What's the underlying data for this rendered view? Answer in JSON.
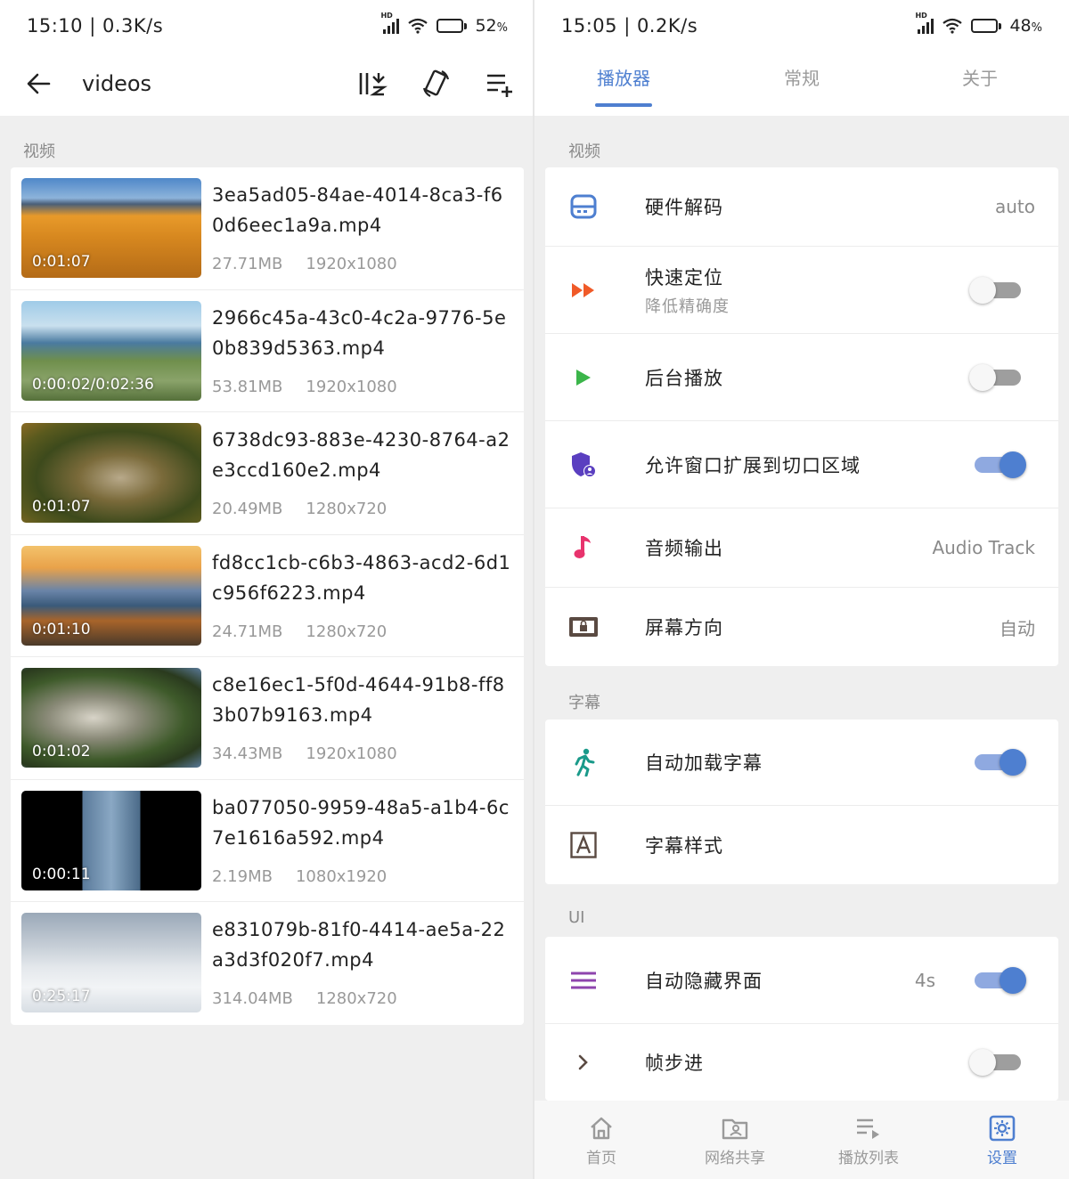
{
  "left": {
    "status": {
      "time": "15:10 | 0.3K/s",
      "battery": "52",
      "battery_unit": "%"
    },
    "appbar": {
      "title": "videos"
    },
    "section_label": "视频",
    "videos": [
      {
        "name": "3ea5ad05-84ae-4014-8ca3-f60d6eec1a9a.mp4",
        "duration": "0:01:07",
        "size": "27.71MB",
        "resolution": "1920x1080"
      },
      {
        "name": "2966c45a-43c0-4c2a-9776-5e0b839d5363.mp4",
        "duration": "0:00:02/0:02:36",
        "size": "53.81MB",
        "resolution": "1920x1080"
      },
      {
        "name": "6738dc93-883e-4230-8764-a2e3ccd160e2.mp4",
        "duration": "0:01:07",
        "size": "20.49MB",
        "resolution": "1280x720"
      },
      {
        "name": "fd8cc1cb-c6b3-4863-acd2-6d1c956f6223.mp4",
        "duration": "0:01:10",
        "size": "24.71MB",
        "resolution": "1280x720"
      },
      {
        "name": "c8e16ec1-5f0d-4644-91b8-ff83b07b9163.mp4",
        "duration": "0:01:02",
        "size": "34.43MB",
        "resolution": "1920x1080"
      },
      {
        "name": "ba077050-9959-48a5-a1b4-6c7e1616a592.mp4",
        "duration": "0:00:11",
        "size": "2.19MB",
        "resolution": "1080x1920"
      },
      {
        "name": "e831079b-81f0-4414-ae5a-22a3d3f020f7.mp4",
        "duration": "0:25:17",
        "size": "314.04MB",
        "resolution": "1280x720"
      }
    ]
  },
  "right": {
    "status": {
      "time": "15:05 | 0.2K/s",
      "battery": "48",
      "battery_unit": "%"
    },
    "tabs": [
      "播放器",
      "常规",
      "关于"
    ],
    "sections": {
      "video": "视频",
      "subtitle": "字幕",
      "ui": "UI"
    },
    "settings": {
      "hw_decode": {
        "label": "硬件解码",
        "value": "auto"
      },
      "fast_seek": {
        "label": "快速定位",
        "sub": "降低精确度",
        "on": false
      },
      "bg_play": {
        "label": "后台播放",
        "on": false
      },
      "cutout": {
        "label": "允许窗口扩展到切口区域",
        "on": true
      },
      "audio_out": {
        "label": "音频输出",
        "value": "Audio Track"
      },
      "orientation": {
        "label": "屏幕方向",
        "value": "自动"
      },
      "auto_sub": {
        "label": "自动加载字幕",
        "on": true
      },
      "sub_style": {
        "label": "字幕样式"
      },
      "auto_hide": {
        "label": "自动隐藏界面",
        "value": "4s",
        "on": true
      },
      "frame_step": {
        "label": "帧步进",
        "on": false
      }
    },
    "nav": [
      "首页",
      "网络共享",
      "播放列表",
      "设置"
    ]
  },
  "colors": {
    "accent": "#4e7fd0",
    "fast_seek_icon": "#f05a28",
    "play_icon": "#3bb54a",
    "cutout_icon": "#5a3fc0",
    "music_icon": "#e8336d",
    "menu_icon": "#8e44ad"
  }
}
